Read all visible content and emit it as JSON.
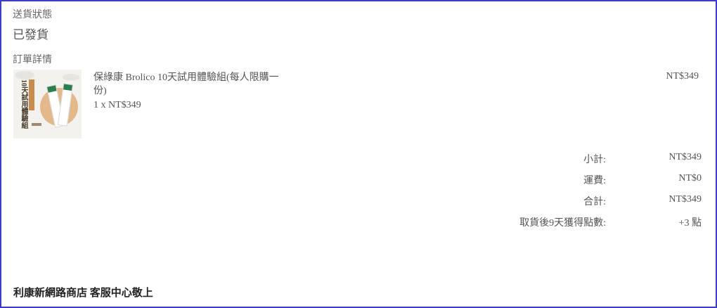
{
  "shipping": {
    "label": "送貨狀態",
    "value": "已發貨"
  },
  "order": {
    "label": "訂單詳情",
    "item": {
      "thumbnail_text": "10天試用體驗組",
      "name": "保綠康 Brolico 10天試用體驗組(每人限購一份)",
      "quantity_price": "1 x NT$349",
      "line_total": "NT$349"
    }
  },
  "summary": {
    "subtotal_label": "小計:",
    "subtotal_value": "NT$349",
    "shipping_label": "運費:",
    "shipping_value": "NT$0",
    "total_label": "合計:",
    "total_value": "NT$349",
    "points_label": "取貨後9天獲得點數:",
    "points_value": "+3 點"
  },
  "footer": {
    "signature": "利康新網路商店 客服中心敬上"
  },
  "colors": {
    "frame_border": "#3c3cc8",
    "text": "#555555"
  }
}
